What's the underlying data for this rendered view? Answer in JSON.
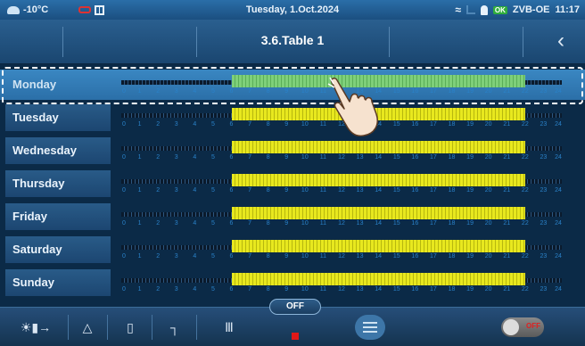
{
  "status_bar": {
    "temperature": "-10°C",
    "date": "Tuesday, 1.Oct.2024",
    "ok_badge": "OK",
    "device": "ZVB-OE",
    "time": "11:17",
    "icons": [
      "weather-icon",
      "link-icon",
      "grid-icon",
      "wifi-icon",
      "signal-icon",
      "person-icon"
    ]
  },
  "header": {
    "title": "3.6.Table 1",
    "back_icon": "chevron-left-icon"
  },
  "schedule": {
    "hours": [
      "0",
      "1",
      "2",
      "3",
      "4",
      "5",
      "6",
      "7",
      "8",
      "9",
      "10",
      "11",
      "12",
      "13",
      "14",
      "15",
      "16",
      "17",
      "18",
      "19",
      "20",
      "21",
      "22",
      "23",
      "24"
    ],
    "days": [
      {
        "label": "Monday",
        "on_from": 6,
        "on_to": 22,
        "selected": true
      },
      {
        "label": "Tuesday",
        "on_from": 6,
        "on_to": 22,
        "selected": false
      },
      {
        "label": "Wednesday",
        "on_from": 6,
        "on_to": 22,
        "selected": false
      },
      {
        "label": "Thursday",
        "on_from": 6,
        "on_to": 22,
        "selected": false
      },
      {
        "label": "Friday",
        "on_from": 6,
        "on_to": 22,
        "selected": false
      },
      {
        "label": "Saturday",
        "on_from": 6,
        "on_to": 22,
        "selected": false
      },
      {
        "label": "Sunday",
        "on_from": 6,
        "on_to": 22,
        "selected": false
      }
    ],
    "colors": {
      "on": "#e8e81e",
      "on_selected": "#7fd07a",
      "selected_row": "#3a87c2"
    }
  },
  "bottom_bar": {
    "mode_label": "OFF",
    "toggle_text": "OFF",
    "icons": [
      "auto-mode-icon",
      "flame-icon",
      "device-icon",
      "tap-icon",
      "radiator-icon",
      "menu-icon"
    ]
  }
}
